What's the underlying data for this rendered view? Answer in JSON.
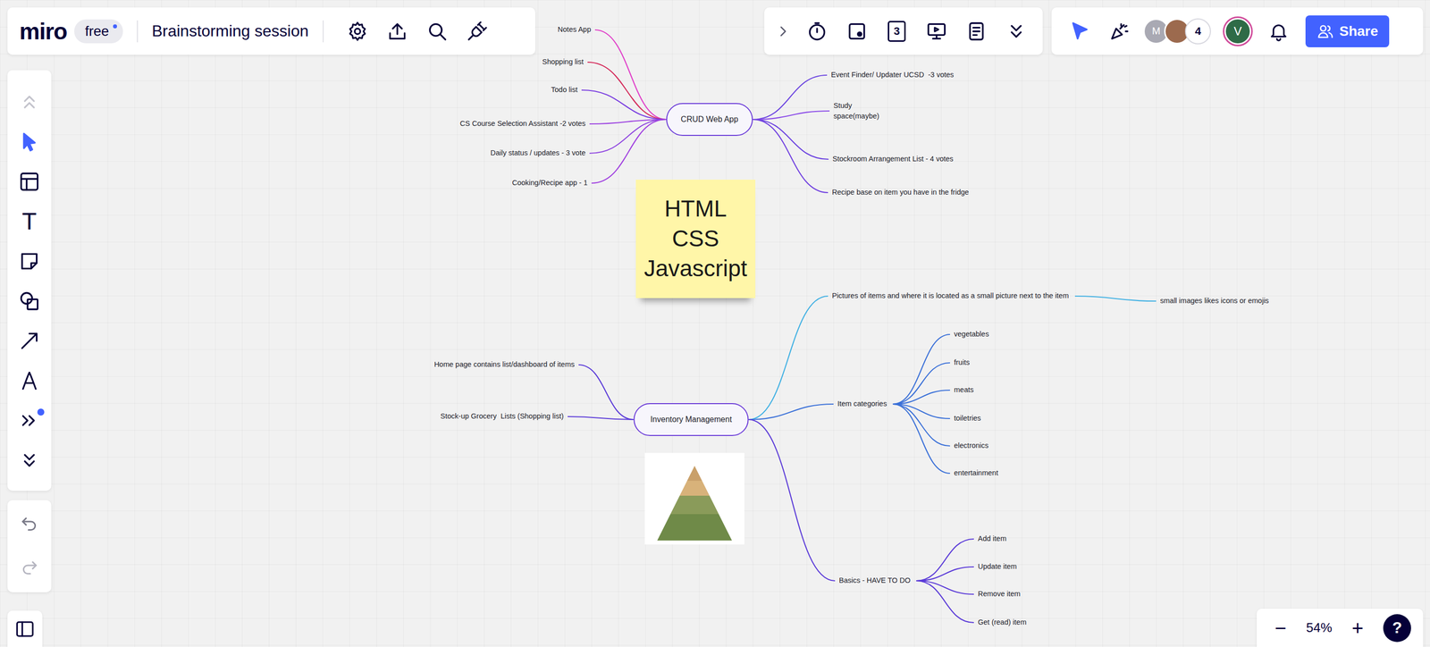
{
  "board": {
    "logo": "miro",
    "plan": "free",
    "title": "Brainstorming session"
  },
  "board_actions": [
    {
      "kind": "settings"
    },
    {
      "kind": "export"
    },
    {
      "kind": "search"
    },
    {
      "kind": "apps"
    }
  ],
  "collab_tools": [
    {
      "kind": "toggle"
    },
    {
      "kind": "timer"
    },
    {
      "kind": "cards"
    },
    {
      "kind": "counter",
      "label": "3"
    },
    {
      "kind": "present"
    },
    {
      "kind": "notes"
    },
    {
      "kind": "expand"
    }
  ],
  "people": {
    "avatars": [
      {
        "kind": "initial",
        "label": "M",
        "color": "#a9a9b3"
      },
      {
        "kind": "photo",
        "color": "#9c6a4e"
      }
    ],
    "count": "4",
    "me": {
      "label": "V",
      "color": "#2f6b47"
    }
  },
  "share": "Share",
  "left_tools": [
    {
      "kind": "collapse",
      "selected": false,
      "disabled": true
    },
    {
      "kind": "select",
      "selected": true,
      "disabled": false
    },
    {
      "kind": "frame",
      "selected": false,
      "disabled": false
    },
    {
      "kind": "text",
      "label": "T",
      "selected": false,
      "disabled": false
    },
    {
      "kind": "sticky",
      "selected": false,
      "disabled": false
    },
    {
      "kind": "shapes",
      "selected": false,
      "disabled": false
    },
    {
      "kind": "connector",
      "selected": false,
      "disabled": false
    },
    {
      "kind": "pen",
      "selected": false,
      "disabled": false
    },
    {
      "kind": "more",
      "selected": false,
      "disabled": false,
      "badge": true
    },
    {
      "kind": "expand",
      "selected": false,
      "disabled": false
    }
  ],
  "history": [
    {
      "kind": "undo",
      "disabled": false
    },
    {
      "kind": "redo",
      "disabled": true
    }
  ],
  "zoom": {
    "out": "−",
    "level": "54%",
    "in": "+",
    "help": "?"
  },
  "sticky_note": {
    "lines": [
      "HTML",
      "CSS",
      "Javascript"
    ]
  },
  "mind_maps": [
    {
      "root": "CRUD Web App",
      "left": [
        {
          "label": "Notes App",
          "color": "#e03fc9"
        },
        {
          "label": "Shopping list",
          "color": "#d42a5a"
        },
        {
          "label": "Todo list",
          "color": "#7a3ee0"
        },
        {
          "label": "CS Course Selection Assistant -2 votes",
          "color": "#9a3ee0"
        },
        {
          "label": "Daily status / updates - 3 vote",
          "color": "#8e44e0"
        },
        {
          "label": "Cooking/Recipe app - 1",
          "color": "#a040e0"
        }
      ],
      "right": [
        {
          "label": "Event Finder/ Updater UCSD  -3 votes",
          "color": "#6b44e0",
          "children": []
        },
        {
          "label": "Study space(maybe)",
          "color": "#8a4ae8",
          "children": []
        },
        {
          "label": "Stockroom Arrangement List - 4 votes",
          "color": "#6a40e0",
          "children": []
        },
        {
          "label": "Recipe base on item you have in the fridge",
          "color": "#7040e0",
          "children": []
        }
      ]
    },
    {
      "root": "Inventory Management",
      "left": [
        {
          "label": "Home page contains list/dashboard of items",
          "color": "#5a3ad8"
        },
        {
          "label": "Stock-up Grocery  Lists (Shopping list)",
          "color": "#5a3ad8"
        }
      ],
      "right": [
        {
          "label": "Pictures of items and where it is located as a small picture next to the item",
          "color": "#3fb0e3",
          "children": [
            {
              "label": "small images likes icons or emojis"
            }
          ]
        },
        {
          "label": "Item categories",
          "color": "#3a70d8",
          "children": [
            {
              "label": "vegetables"
            },
            {
              "label": "fruits"
            },
            {
              "label": "meats"
            },
            {
              "label": "toiletries"
            },
            {
              "label": "electronics"
            },
            {
              "label": "entertainment"
            }
          ]
        },
        {
          "label": "Basics - HAVE TO DO",
          "color": "#5a3ad8",
          "children": [
            {
              "label": "Add item"
            },
            {
              "label": "Update item"
            },
            {
              "label": "Remove item"
            },
            {
              "label": "Get (read) item"
            }
          ]
        }
      ]
    }
  ]
}
